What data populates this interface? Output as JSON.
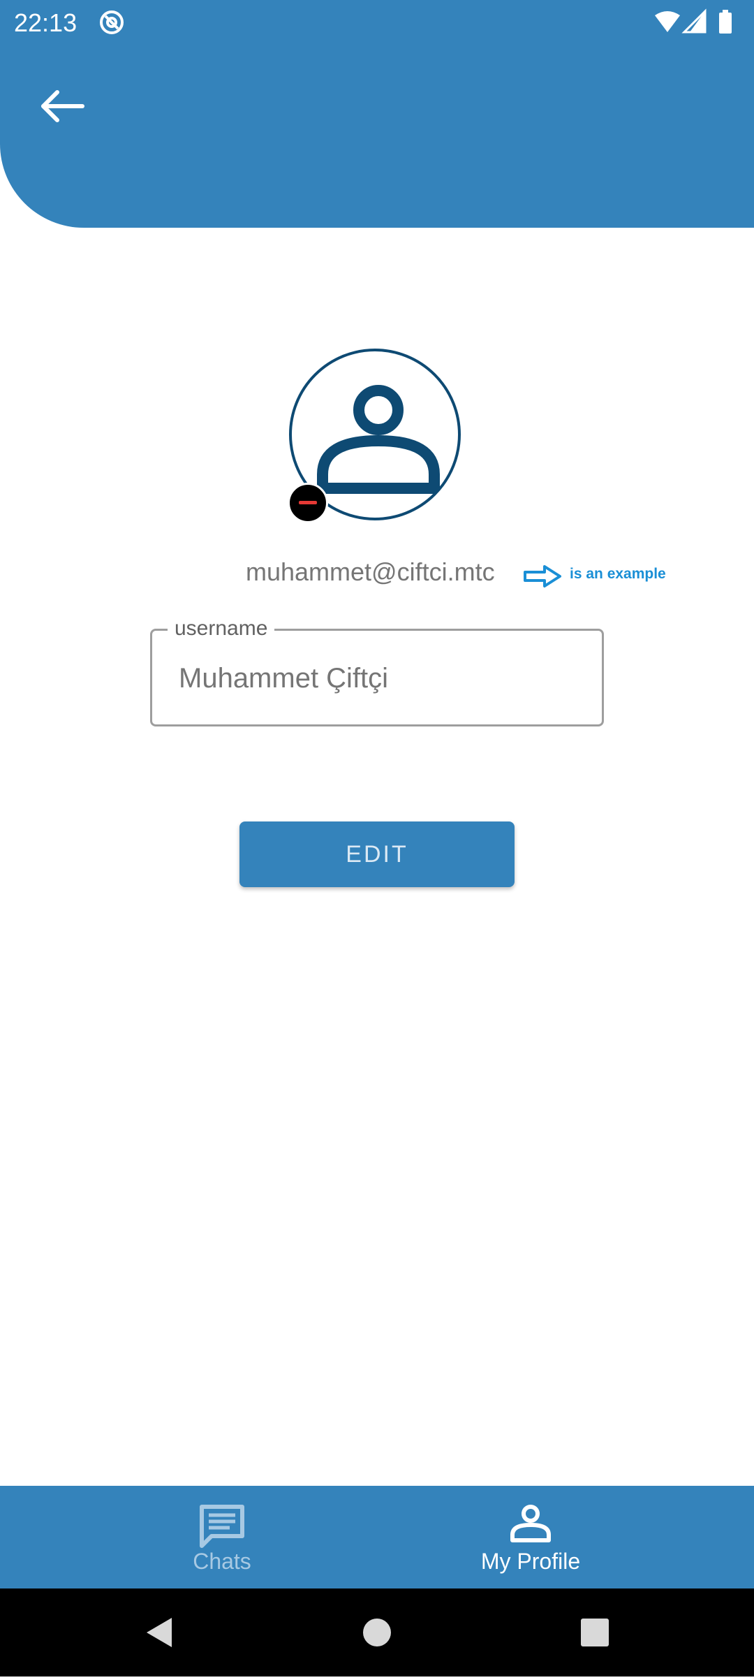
{
  "status_bar": {
    "time": "22:13",
    "icons": [
      "at-sign-icon",
      "wifi-icon",
      "signal-icon",
      "battery-icon"
    ]
  },
  "header": {
    "back_icon": "arrow-left-icon",
    "color": "#3483bb"
  },
  "profile": {
    "avatar_icon": "person-icon",
    "remove_icon": "minus-circle-icon",
    "email": "muhammet@ciftci.mtc",
    "example_note": "is an example",
    "username_label": "username",
    "username_value": "Muhammet Çiftçi",
    "edit_label": "EDIT"
  },
  "bottom_nav": {
    "items": [
      {
        "label": "Chats",
        "icon": "chat-icon",
        "active": false
      },
      {
        "label": "My Profile",
        "icon": "person-icon",
        "active": true
      }
    ]
  },
  "system_nav": {
    "buttons": [
      "back-triangle-icon",
      "home-circle-icon",
      "recents-square-icon"
    ]
  },
  "colors": {
    "primary": "#3483bb",
    "avatar_outline": "#0e4a73",
    "note_blue": "#1a8fd6"
  }
}
